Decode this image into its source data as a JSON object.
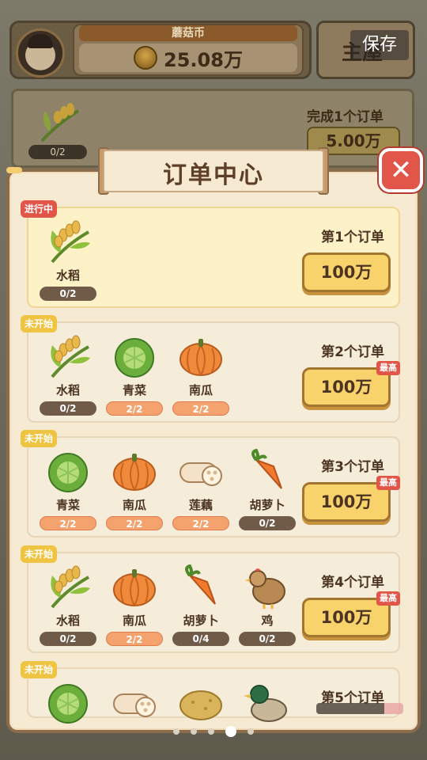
{
  "hud": {
    "currency_label": "蘑菇币",
    "currency_value": "25.08万",
    "home_label": "主屋",
    "save_label": "保存"
  },
  "bg_order": {
    "progress": "0/2",
    "complete_label": "完成1个订单",
    "reward": "5.00万"
  },
  "modal": {
    "title": "订单中心",
    "close": "✕"
  },
  "orders": [
    {
      "status": "进行中",
      "label": "第1个订单",
      "reward": "100万",
      "best": "",
      "items": [
        {
          "name": "水稻",
          "icon": "rice-icon",
          "progress": "0/2"
        }
      ]
    },
    {
      "status": "未开始",
      "label": "第2个订单",
      "reward": "100万",
      "best": "最高",
      "items": [
        {
          "name": "水稻",
          "icon": "rice-icon",
          "progress": "0/2"
        },
        {
          "name": "青菜",
          "icon": "cabbage-icon",
          "progress": "2/2"
        },
        {
          "name": "南瓜",
          "icon": "pumpkin-icon",
          "progress": "2/2"
        }
      ]
    },
    {
      "status": "未开始",
      "label": "第3个订单",
      "reward": "100万",
      "best": "最高",
      "items": [
        {
          "name": "青菜",
          "icon": "cabbage-icon",
          "progress": "2/2"
        },
        {
          "name": "南瓜",
          "icon": "pumpkin-icon",
          "progress": "2/2"
        },
        {
          "name": "莲藕",
          "icon": "lotus-root-icon",
          "progress": "2/2"
        },
        {
          "name": "胡萝卜",
          "icon": "carrot-icon",
          "progress": "0/2"
        }
      ]
    },
    {
      "status": "未开始",
      "label": "第4个订单",
      "reward": "100万",
      "best": "最高",
      "items": [
        {
          "name": "水稻",
          "icon": "rice-icon",
          "progress": "0/2"
        },
        {
          "name": "南瓜",
          "icon": "pumpkin-icon",
          "progress": "2/2"
        },
        {
          "name": "胡萝卜",
          "icon": "carrot-icon",
          "progress": "0/4"
        },
        {
          "name": "鸡",
          "icon": "chicken-icon",
          "progress": "0/2"
        }
      ]
    },
    {
      "status": "未开始",
      "label": "第5个订单",
      "items": [
        {
          "icon": "cabbage-icon"
        },
        {
          "icon": "lotus-root-icon"
        },
        {
          "icon": "potato-icon"
        },
        {
          "icon": "duck-icon"
        }
      ]
    }
  ],
  "colors": {
    "accent": "#f8d26b",
    "danger": "#e2564a",
    "panel": "#f6ead3"
  }
}
